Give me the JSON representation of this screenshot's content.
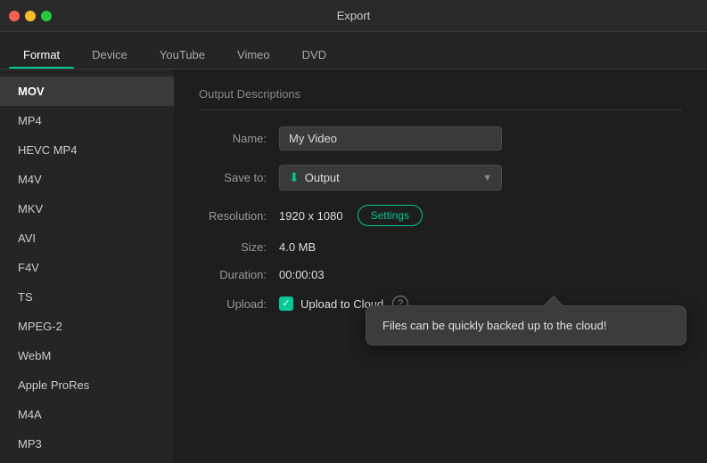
{
  "titlebar": {
    "title": "Export"
  },
  "tabs": [
    {
      "id": "format",
      "label": "Format",
      "active": true
    },
    {
      "id": "device",
      "label": "Device",
      "active": false
    },
    {
      "id": "youtube",
      "label": "YouTube",
      "active": false
    },
    {
      "id": "vimeo",
      "label": "Vimeo",
      "active": false
    },
    {
      "id": "dvd",
      "label": "DVD",
      "active": false
    }
  ],
  "sidebar": {
    "items": [
      {
        "id": "mov",
        "label": "MOV",
        "active": true
      },
      {
        "id": "mp4",
        "label": "MP4",
        "active": false
      },
      {
        "id": "hevc-mp4",
        "label": "HEVC MP4",
        "active": false
      },
      {
        "id": "m4v",
        "label": "M4V",
        "active": false
      },
      {
        "id": "mkv",
        "label": "MKV",
        "active": false
      },
      {
        "id": "avi",
        "label": "AVI",
        "active": false
      },
      {
        "id": "f4v",
        "label": "F4V",
        "active": false
      },
      {
        "id": "ts",
        "label": "TS",
        "active": false
      },
      {
        "id": "mpeg2",
        "label": "MPEG-2",
        "active": false
      },
      {
        "id": "webm",
        "label": "WebM",
        "active": false
      },
      {
        "id": "apple-prores",
        "label": "Apple ProRes",
        "active": false
      },
      {
        "id": "m4a",
        "label": "M4A",
        "active": false
      },
      {
        "id": "mp3",
        "label": "MP3",
        "active": false
      }
    ]
  },
  "content": {
    "section_title": "Output Descriptions",
    "fields": {
      "name_label": "Name:",
      "name_value": "My Video",
      "save_to_label": "Save to:",
      "save_to_value": "Output",
      "resolution_label": "Resolution:",
      "resolution_value": "1920 x 1080",
      "size_label": "Size:",
      "size_value": "4.0 MB",
      "duration_label": "Duration:",
      "duration_value": "00:00:03",
      "upload_label": "Upload:",
      "upload_to_cloud_label": "Upload to Cloud",
      "settings_label": "Settings"
    },
    "tooltip": {
      "text": "Files can be quickly backed up to the cloud!"
    }
  }
}
